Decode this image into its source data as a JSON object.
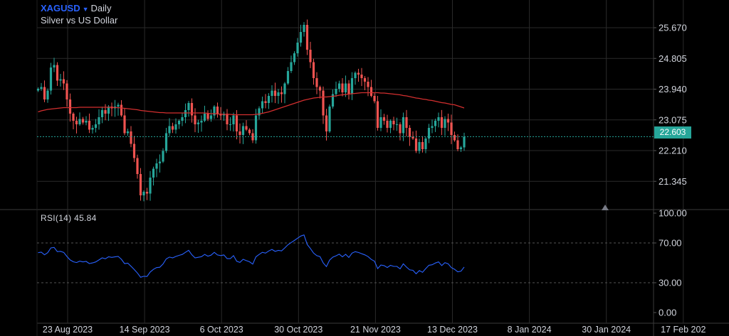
{
  "header": {
    "symbol": "XAGUSD",
    "dropdown_icon": "caret-down-icon",
    "interval": "Daily",
    "description": "Silver vs US Dollar"
  },
  "current_price": "22.603",
  "rsi": {
    "label": "RSI(14)",
    "value": "45.84"
  },
  "colors": {
    "up": "#26a69a",
    "down": "#ef5350",
    "ma": "#d32f2f",
    "rsi_line": "#2962ff",
    "grid": "#2a2a2a",
    "accent": "#2962ff",
    "price_line": "#26a69a"
  },
  "chart_data": [
    {
      "type": "candlestick",
      "title": "XAGUSD Daily",
      "x_tick_labels": [
        "23 Aug 2023",
        "14 Sep 2023",
        "6 Oct 2023",
        "30 Oct 2023",
        "21 Nov 2023",
        "13 Dec 2023",
        "8 Jan 2024",
        "30 Jan 2024",
        "17 Feb 202"
      ],
      "y_tick_labels": [
        "25.670",
        "24.805",
        "23.940",
        "23.075",
        "22.210",
        "21.345"
      ],
      "ylim": [
        20.55,
        26.45
      ],
      "close": [
        23.95,
        24.0,
        23.65,
        23.9,
        24.55,
        24.62,
        24.18,
        24.22,
        24.1,
        23.65,
        23.25,
        23.05,
        22.95,
        23.1,
        23.0,
        23.05,
        22.8,
        22.85,
        22.95,
        23.15,
        23.35,
        23.25,
        23.45,
        23.4,
        23.45,
        23.5,
        23.2,
        22.7,
        22.75,
        22.4,
        22.0,
        21.55,
        20.95,
        21.05,
        21.0,
        21.45,
        21.7,
        21.85,
        21.9,
        22.2,
        22.7,
        22.9,
        22.8,
        22.95,
        23.05,
        23.15,
        23.35,
        23.55,
        23.2,
        22.95,
        23.0,
        23.05,
        23.25,
        23.1,
        23.2,
        23.45,
        23.25,
        23.2,
        23.25,
        22.95,
        22.95,
        23.2,
        22.75,
        22.65,
        22.9,
        22.8,
        22.7,
        22.5,
        23.2,
        23.4,
        23.6,
        23.55,
        23.75,
        23.9,
        23.75,
        23.85,
        23.8,
        24.1,
        24.45,
        24.7,
        24.95,
        25.25,
        25.55,
        25.75,
        25.05,
        24.7,
        24.25,
        24.0,
        23.9,
        23.2,
        22.75,
        23.45,
        23.8,
        23.95,
        24.1,
        23.85,
        24.1,
        23.8,
        24.25,
        24.4,
        24.35,
        24.25,
        24.15,
        24.0,
        23.75,
        23.6,
        22.85,
        23.15,
        23.05,
        22.85,
        23.05,
        22.95,
        22.95,
        22.7,
        23.15,
        22.85,
        22.6,
        22.55,
        22.2,
        22.45,
        22.25,
        22.55,
        22.85,
        22.9,
        23.05,
        23.15,
        22.85,
        23.1,
        23.0,
        22.65,
        22.5,
        22.25,
        22.3,
        22.6
      ],
      "series": [
        {
          "name": "SMA",
          "type": "line",
          "values": [
            23.3,
            23.33,
            23.35,
            23.37,
            23.38,
            23.39,
            23.4,
            23.41,
            23.42,
            23.42,
            23.42,
            23.42,
            23.42,
            23.43,
            23.43,
            23.43,
            23.43,
            23.43,
            23.43,
            23.43,
            23.43,
            23.43,
            23.43,
            23.43,
            23.42,
            23.42,
            23.41,
            23.4,
            23.39,
            23.38,
            23.37,
            23.36,
            23.34,
            23.33,
            23.32,
            23.31,
            23.3,
            23.29,
            23.28,
            23.28,
            23.27,
            23.27,
            23.27,
            23.27,
            23.27,
            23.27,
            23.27,
            23.27,
            23.27,
            23.27,
            23.27,
            23.27,
            23.27,
            23.26,
            23.25,
            23.25,
            23.24,
            23.24,
            23.23,
            23.23,
            23.23,
            23.22,
            23.22,
            23.22,
            23.22,
            23.22,
            23.22,
            23.22,
            23.23,
            23.24,
            23.26,
            23.28,
            23.3,
            23.33,
            23.36,
            23.39,
            23.42,
            23.45,
            23.48,
            23.51,
            23.54,
            23.57,
            23.6,
            23.63,
            23.65,
            23.67,
            23.69,
            23.7,
            23.71,
            23.72,
            23.72,
            23.73,
            23.74,
            23.75,
            23.77,
            23.78,
            23.79,
            23.8,
            23.81,
            23.82,
            23.83,
            23.84,
            23.84,
            23.84,
            23.84,
            23.84,
            23.84,
            23.83,
            23.83,
            23.82,
            23.81,
            23.8,
            23.79,
            23.78,
            23.76,
            23.75,
            23.73,
            23.71,
            23.69,
            23.68,
            23.66,
            23.65,
            23.63,
            23.62,
            23.6,
            23.58,
            23.56,
            23.55,
            23.53,
            23.51,
            23.5,
            23.47,
            23.44,
            23.41
          ]
        },
        {
          "name": "RSI",
          "type": "line",
          "ylim": [
            0,
            100
          ],
          "y_tick_labels": [
            "100.00",
            "70.00",
            "30.00",
            "0.00"
          ],
          "values": [
            60.2,
            60.8,
            58.1,
            60.2,
            65.0,
            65.5,
            61.3,
            61.6,
            60.5,
            56.4,
            52.9,
            51.1,
            50.3,
            51.7,
            50.9,
            51.4,
            49.3,
            49.9,
            50.9,
            52.9,
            55.0,
            54.1,
            56.1,
            55.5,
            56.0,
            56.5,
            53.6,
            49.2,
            49.7,
            46.6,
            43.3,
            39.8,
            35.5,
            36.5,
            36.3,
            40.8,
            43.4,
            45.2,
            45.6,
            48.8,
            53.9,
            55.8,
            55.0,
            56.4,
            57.5,
            58.4,
            60.6,
            62.6,
            58.1,
            55.0,
            55.6,
            56.2,
            58.5,
            56.7,
            57.7,
            60.6,
            57.9,
            57.3,
            57.9,
            54.2,
            54.2,
            57.2,
            51.6,
            50.4,
            53.6,
            52.2,
            51.1,
            48.7,
            56.1,
            58.4,
            60.6,
            59.8,
            61.9,
            63.5,
            61.5,
            62.5,
            62.0,
            65.0,
            68.2,
            70.4,
            72.5,
            74.8,
            76.9,
            78.1,
            68.5,
            64.4,
            59.8,
            57.2,
            56.3,
            49.9,
            46.2,
            52.8,
            55.7,
            57.1,
            58.7,
            56.1,
            58.6,
            55.4,
            59.8,
            61.2,
            60.4,
            59.2,
            58.0,
            56.3,
            53.4,
            51.7,
            44.2,
            47.8,
            47.2,
            45.3,
            47.5,
            46.4,
            46.4,
            44.0,
            49.0,
            45.7,
            42.9,
            42.5,
            39.0,
            42.2,
            40.5,
            44.2,
            47.6,
            48.1,
            49.8,
            51.0,
            47.3,
            50.2,
            49.1,
            45.2,
            43.5,
            40.9,
            41.6,
            45.8
          ]
        }
      ]
    }
  ]
}
